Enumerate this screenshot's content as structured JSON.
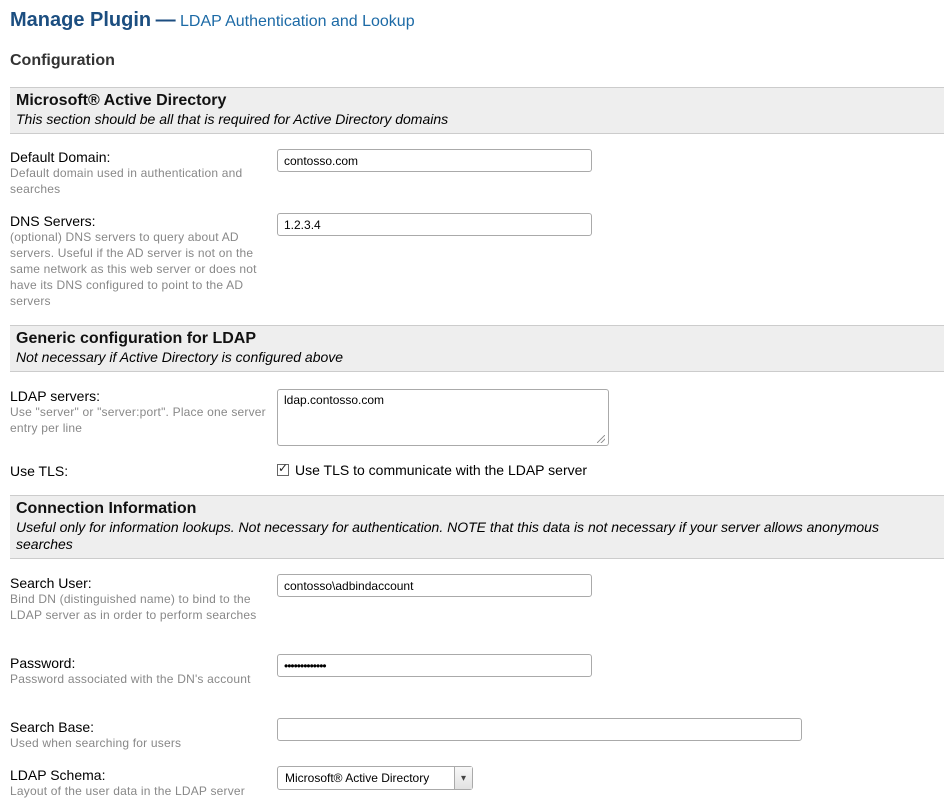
{
  "header": {
    "title": "Manage Plugin",
    "separator": "—",
    "subtitle": "LDAP Authentication and Lookup",
    "configuration_heading": "Configuration"
  },
  "sections": [
    {
      "title": "Microsoft® Active Directory",
      "description": "This section should be all that is required for Active Directory domains",
      "fields": [
        {
          "label": "Default Domain:",
          "help": "Default domain used in authentication and searches",
          "type": "text",
          "value": "contosso.com"
        },
        {
          "label": "DNS Servers:",
          "help": "(optional) DNS servers to query about AD servers. Useful if the AD server is not on the same network as this web server or does not have its DNS configured to point to the AD servers",
          "type": "text",
          "value": "1.2.3.4"
        }
      ]
    },
    {
      "title": "Generic configuration for LDAP",
      "description": "Not necessary if Active Directory is configured above",
      "fields": [
        {
          "label": "LDAP servers:",
          "help": "Use \"server\" or \"server:port\". Place one server entry per line",
          "type": "textarea",
          "value": "ldap.contosso.com"
        },
        {
          "label": "Use TLS:",
          "type": "checkbox",
          "checked": true,
          "checkbox_label": "Use TLS to communicate with the LDAP server"
        }
      ]
    },
    {
      "title": "Connection Information",
      "description": "Useful only for information lookups. Not necessary for authentication. NOTE that this data is not necessary if your server allows anonymous searches",
      "fields": [
        {
          "label": "Search User:",
          "help": "Bind DN (distinguished name) to bind to the LDAP server as in order to perform searches",
          "type": "text",
          "value": "contosso\\adbindaccount"
        },
        {
          "label": "Password:",
          "help": "Password associated with the DN's account",
          "type": "password",
          "value": "•••••••••••••"
        },
        {
          "label": "Search Base:",
          "help": "Used when searching for users",
          "type": "text",
          "value": ""
        },
        {
          "label": "LDAP Schema:",
          "help": "Layout of the user data in the LDAP server",
          "type": "select",
          "selected": "Microsoft® Active Directory"
        }
      ]
    }
  ],
  "colors": {
    "title": "#1c4e80",
    "subtitle": "#1c6aa6",
    "section_background": "#eeeeee",
    "help_text": "#888888"
  }
}
